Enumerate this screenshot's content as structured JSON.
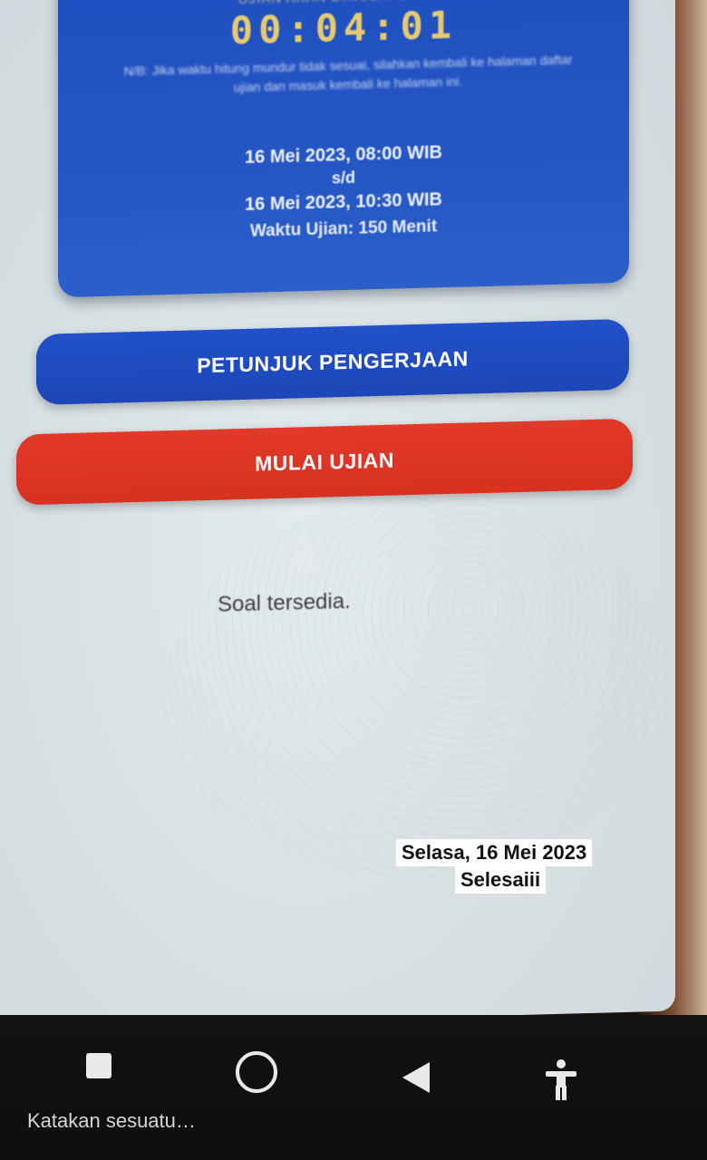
{
  "exam_card": {
    "heading": "UJIAN AKAN DIMULAI DALAM",
    "countdown": "00:04:01",
    "note": "N/B: Jika waktu hitung mundur tidak sesuai, silahkan kembali ke halaman daftar ujian dan masuk kembali ke halaman ini.",
    "start": "16 Mei 2023, 08:00 WIB",
    "separator": "s/d",
    "end": "16 Mei 2023, 10:30 WIB",
    "duration": "Waktu Ujian: 150 Menit"
  },
  "buttons": {
    "guide_label": "PETUNJUK PENGERJAAN",
    "start_label": "MULAI UJIAN"
  },
  "status": "Soal tersedia.",
  "stickers": {
    "date": "Selasa, 16 Mei 2023",
    "done": "Selesaiii"
  },
  "navbar": {
    "icons": [
      "recent-apps-icon",
      "home-icon",
      "back-icon",
      "accessibility-icon"
    ]
  },
  "caption": "Katakan sesuatu…",
  "colors": {
    "card_blue": "#2556c4",
    "guide_blue": "#1f4cc2",
    "start_red": "#dd3525",
    "countdown_gold": "#e7c96f"
  }
}
